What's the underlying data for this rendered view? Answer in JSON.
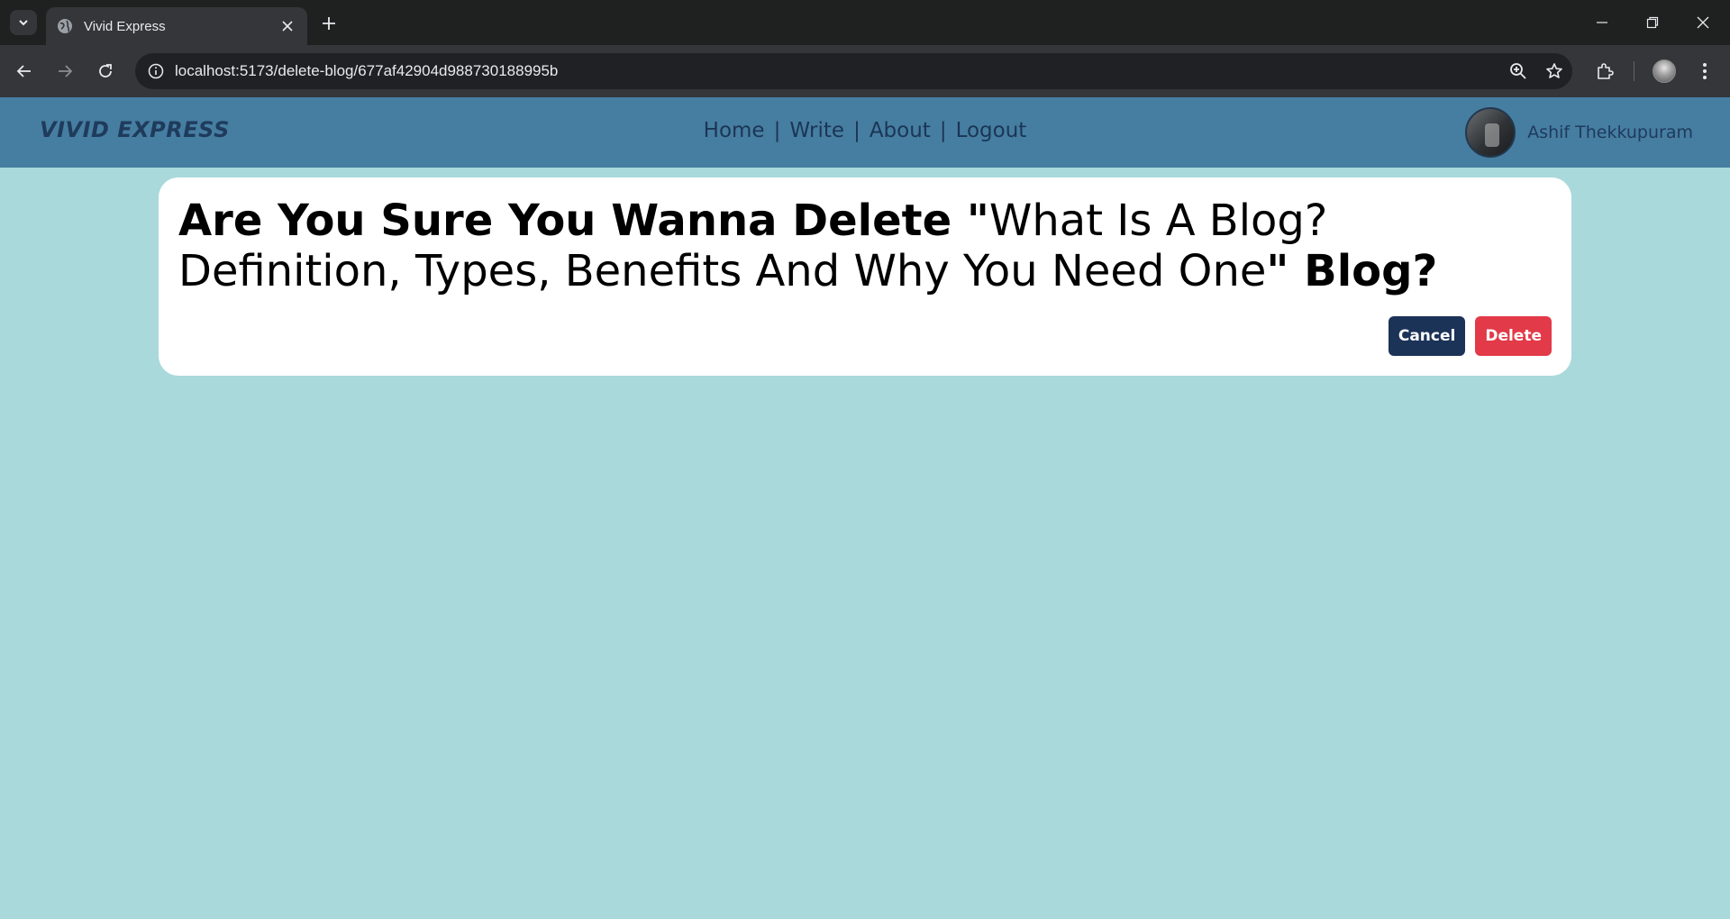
{
  "browser": {
    "tab_title": "Vivid Express",
    "url": "localhost:5173/delete-blog/677af42904d988730188995b",
    "icons": [
      "tab-search-icon",
      "globe-icon",
      "close-icon",
      "plus-icon",
      "minimize-icon",
      "restore-icon",
      "close-window-icon",
      "back-icon",
      "forward-icon",
      "reload-icon",
      "info-icon",
      "zoom-icon",
      "star-icon",
      "extensions-icon",
      "profile-icon",
      "more-icon"
    ]
  },
  "app": {
    "logo": "VIVID EXPRESS",
    "nav": {
      "home": "Home",
      "write": "Write",
      "about": "About",
      "logout": "Logout",
      "separator": "|"
    },
    "user_name": "Ashif Thekkupuram"
  },
  "dialog": {
    "prefix": "Are You Sure You Wanna Delete \"",
    "blog_title": "What Is A Blog? Definition, Types, Benefits And Why You Need One",
    "suffix": "\" Blog?",
    "cancel_label": "Cancel",
    "delete_label": "Delete"
  },
  "colors": {
    "page_bg": "#a9d9db",
    "navbar_bg": "#467ea1",
    "cancel_bg": "#1c3358",
    "delete_bg": "#e23a48"
  }
}
